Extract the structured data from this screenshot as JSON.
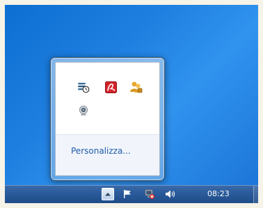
{
  "tray_flyout": {
    "icons": [
      {
        "name": "network-sync-icon"
      },
      {
        "name": "avira-antivirus-icon"
      },
      {
        "name": "user-accounts-icon"
      },
      {
        "name": "webcam-icon"
      }
    ],
    "customize_label": "Personalizza..."
  },
  "taskbar": {
    "clock": "08:23",
    "icons": [
      "chevron-up-icon",
      "action-center-flag-icon",
      "network-error-icon",
      "speaker-volume-icon"
    ]
  },
  "colors": {
    "desktop_blue": "#1f7fe0",
    "link_blue": "#1e5aa8",
    "avira_red": "#d4232b"
  }
}
